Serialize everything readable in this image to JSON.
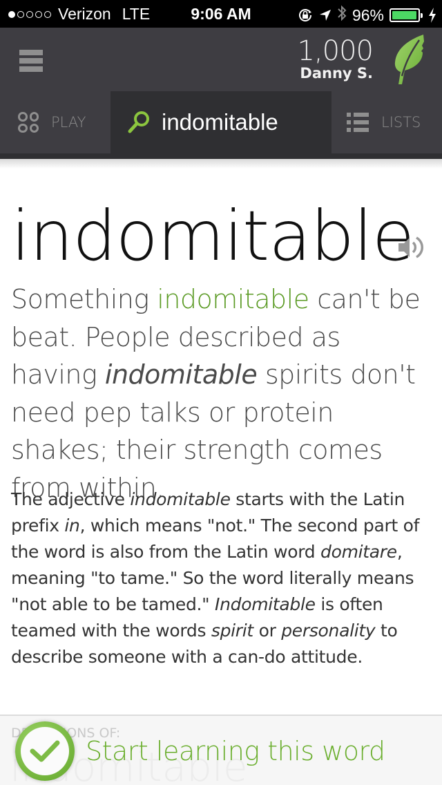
{
  "status_bar": {
    "signal_dots_filled": 1,
    "signal_dots_total": 5,
    "carrier": "Verizon",
    "network": "LTE",
    "time": "9:06 AM",
    "battery_percent": "96%",
    "battery_level": 0.96,
    "icons": [
      "rotation-lock-icon",
      "location-arrow-icon",
      "bluetooth-icon",
      "battery-icon",
      "charging-bolt-icon"
    ]
  },
  "header": {
    "menu_icon": "hamburger-menu-icon",
    "points": "1,000",
    "user_name": "Danny S.",
    "logo_icon": "leaf-icon",
    "brand_color": "#7cbb45"
  },
  "tabs": [
    {
      "label": "PLAY",
      "icon": "grid-circles-icon"
    },
    {
      "label": "indomitable",
      "icon": "search-icon",
      "active": true
    },
    {
      "label": "LISTS",
      "icon": "list-icon"
    }
  ],
  "word": {
    "title": "indomitable",
    "audio_icon": "speaker-icon",
    "short_def": {
      "before": "Something ",
      "highlight": "indomitable",
      "after1": " can't be beat. People described as having ",
      "italic": "indomitable",
      "after2": " spirits don't need pep talks or protein shakes; their strength comes from within."
    },
    "long_def": [
      {
        "t": "The adjective ",
        "i": false
      },
      {
        "t": "indomitable",
        "i": true
      },
      {
        "t": " starts with the Latin prefix ",
        "i": false
      },
      {
        "t": "in",
        "i": true
      },
      {
        "t": ", which means \"not.\" The second part of the word is also from the Latin word ",
        "i": false
      },
      {
        "t": "domitare",
        "i": true
      },
      {
        "t": ", meaning \"to tame.\" So the word literally means \"not able to be tamed.\" ",
        "i": false
      },
      {
        "t": "Indomitable",
        "i": true
      },
      {
        "t": " is often teamed with the words ",
        "i": false
      },
      {
        "t": "spirit",
        "i": true
      },
      {
        "t": " or ",
        "i": false
      },
      {
        "t": "personality",
        "i": true
      },
      {
        "t": " to describe someone with a can-do attitude.",
        "i": false
      }
    ],
    "highlight_color": "#5a9a23"
  },
  "bottom": {
    "section_label": "DEFINITIONS OF:",
    "ghost_word": "indomitable",
    "learn_button_label": "Start learning this word",
    "learn_icon": "checkmark-circle-icon",
    "learn_color": "#6aae2d"
  }
}
